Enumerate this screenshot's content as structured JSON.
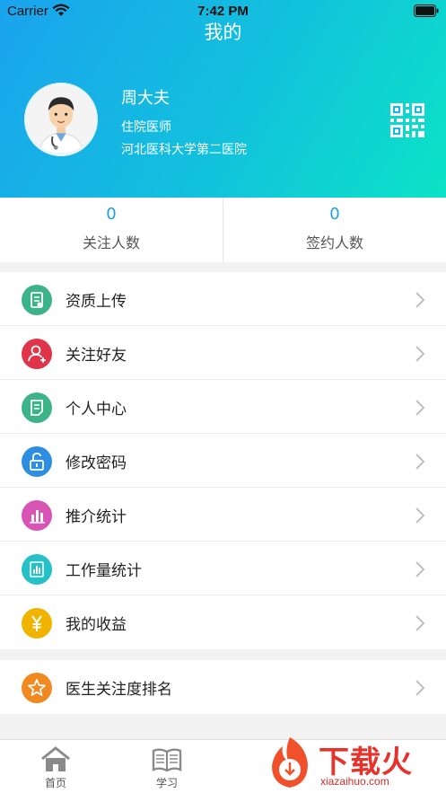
{
  "status_bar": {
    "carrier": "Carrier",
    "time": "7:42 PM"
  },
  "header": {
    "title": "我的"
  },
  "profile": {
    "name": "周大夫",
    "title": "住院医师",
    "hospital": "河北医科大学第二医院"
  },
  "stats": [
    {
      "value": "0",
      "label": "关注人数"
    },
    {
      "value": "0",
      "label": "签约人数"
    }
  ],
  "menu": [
    {
      "label": "资质上传",
      "icon": "certificate-upload-icon",
      "color": "#3db38a"
    },
    {
      "label": "关注好友",
      "icon": "add-friend-icon",
      "color": "#e0344a"
    },
    {
      "label": "个人中心",
      "icon": "profile-document-icon",
      "color": "#3db38a"
    },
    {
      "label": "修改密码",
      "icon": "unlock-icon",
      "color": "#2f8ee0"
    },
    {
      "label": "推介统计",
      "icon": "bar-chart-icon",
      "color": "#d855b6"
    },
    {
      "label": "工作量统计",
      "icon": "workload-chart-icon",
      "color": "#25c0c8"
    },
    {
      "label": "我的收益",
      "icon": "yen-icon",
      "color": "#f0b400"
    }
  ],
  "menu2": [
    {
      "label": "医生关注度排名",
      "icon": "star-icon",
      "color": "#f08a20"
    }
  ],
  "tabs": [
    {
      "label": "首页",
      "icon": "home-icon"
    },
    {
      "label": "学习",
      "icon": "book-icon"
    }
  ],
  "watermark": {
    "text": "下载火",
    "sub": "xiazaihuo.com"
  }
}
